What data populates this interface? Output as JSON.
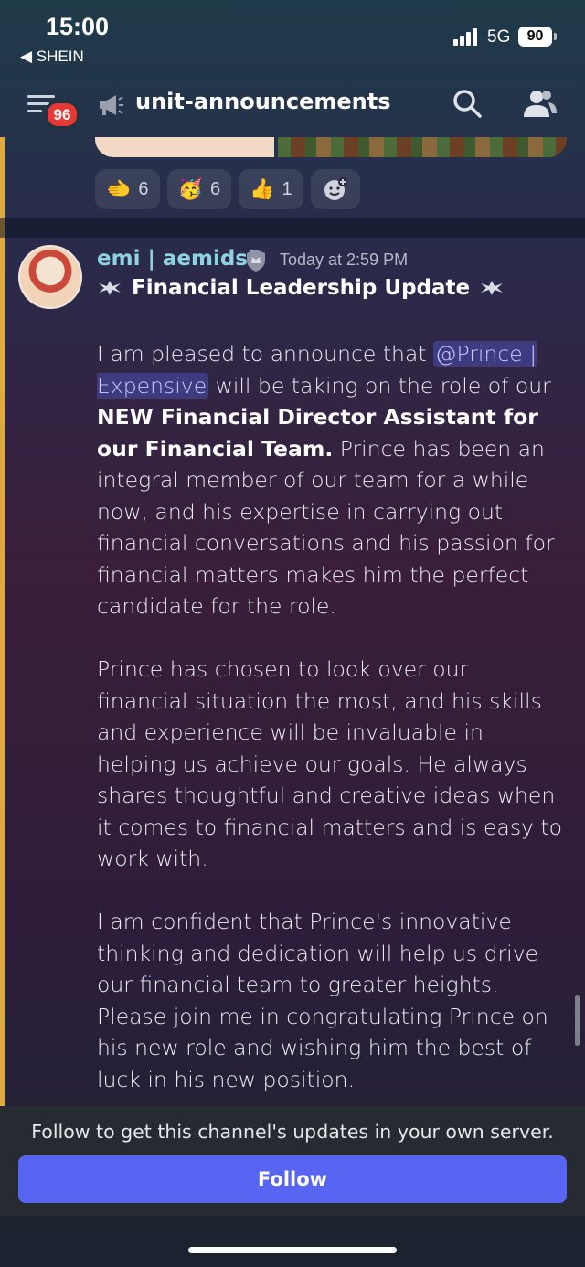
{
  "status": {
    "time": "15:00",
    "back_app": "SHEIN",
    "network": "5G",
    "battery": "90"
  },
  "header": {
    "notification_count": "96",
    "channel_name": "unit-announcements"
  },
  "reactions": [
    {
      "emoji": "🫲",
      "count": "6"
    },
    {
      "emoji": "🥳",
      "count": "6"
    },
    {
      "emoji": "👍",
      "count": "1"
    }
  ],
  "message": {
    "username": "emi | aemidst",
    "timestamp": "Today at 2:59 PM",
    "title": "Financial Leadership Update",
    "p1_start": "I am pleased to announce that ",
    "mention": "@Prince | Expensive",
    "p1_mid": " will be taking on the role of our ",
    "p1_bold": "NEW Financial Director Assistant for our Financial Team.",
    "p1_end": " Prince has been an integral member of our team for a while now, and his expertise in carrying out financial conversations and his passion for financial matters makes him the perfect candidate for the role.",
    "p2": "Prince has chosen to look over our financial situation the most, and his skills and experience will be invaluable in helping us achieve our goals. He always shares thoughtful and creative ideas when it comes to financial matters and is easy to work with.",
    "p3": "I am confident that Prince's innovative thinking and dedication will help us drive our financial team to greater heights. Please join me in congratulating Prince on his new role and wishing him the best of luck in his new position."
  },
  "follow": {
    "text": "Follow to get this channel's updates in your own server.",
    "button_label": "Follow"
  },
  "colors": {
    "accent": "#5865f2",
    "username": "#8fd3e0",
    "badge": "#e53935",
    "rail": "#e0a93a"
  }
}
